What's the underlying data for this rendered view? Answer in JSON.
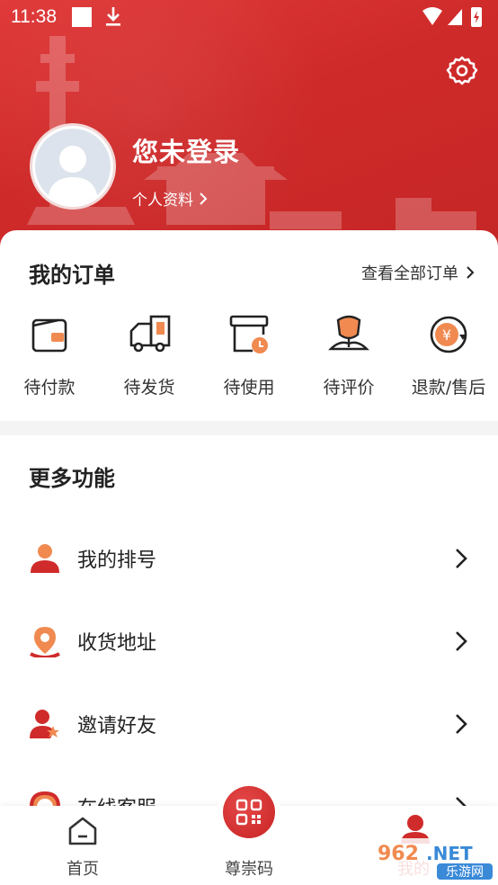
{
  "status": {
    "time": "11:38"
  },
  "profile": {
    "title": "您未登录",
    "link_label": "个人资料"
  },
  "orders": {
    "title": "我的订单",
    "view_all": "查看全部订单",
    "items": [
      {
        "label": "待付款",
        "icon": "wallet-icon"
      },
      {
        "label": "待发货",
        "icon": "truck-icon"
      },
      {
        "label": "待使用",
        "icon": "box-clock-icon"
      },
      {
        "label": "待评价",
        "icon": "flower-icon"
      },
      {
        "label": "退款/售后",
        "icon": "yen-refund-icon"
      }
    ]
  },
  "more": {
    "title": "更多功能",
    "items": [
      {
        "label": "我的排号",
        "icon": "user-icon"
      },
      {
        "label": "收货地址",
        "icon": "location-icon"
      },
      {
        "label": "邀请好友",
        "icon": "invite-icon"
      },
      {
        "label": "在线客服",
        "icon": "service-icon"
      }
    ]
  },
  "tabbar": {
    "items": [
      {
        "label": "首页",
        "icon": "home-icon"
      },
      {
        "label": "尊崇码",
        "icon": "qr-code-icon"
      },
      {
        "label": "我的",
        "icon": "profile-icon"
      }
    ]
  },
  "watermark": {
    "text": "962.NET",
    "sub": "乐游网"
  },
  "colors": {
    "brand_red": "#d02b2b",
    "accent_orange": "#f08a50"
  }
}
